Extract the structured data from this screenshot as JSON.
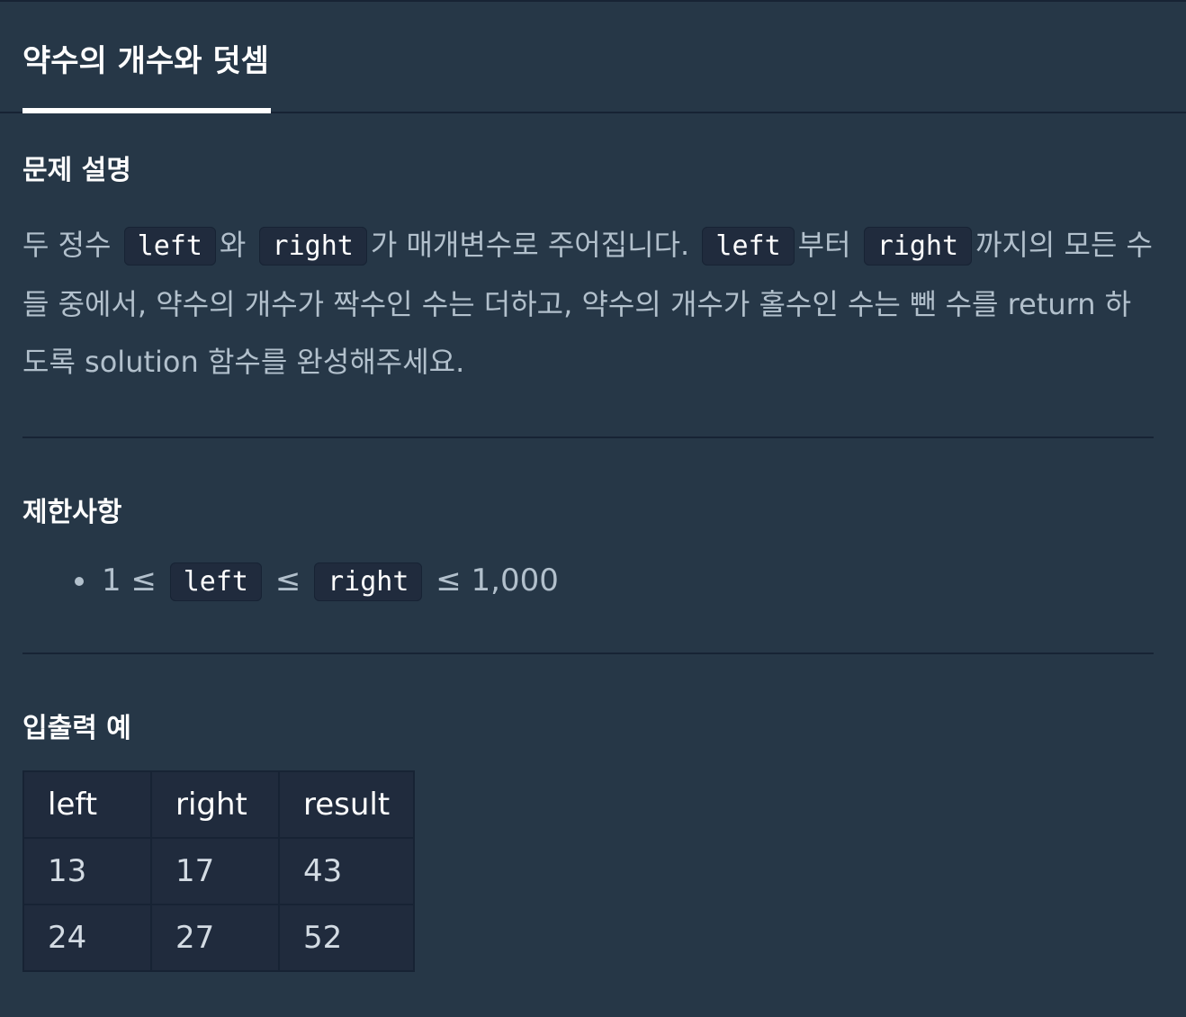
{
  "tab": {
    "title": "약수의 개수와 덧셈"
  },
  "description": {
    "title": "문제 설명",
    "parts": [
      "두 정수",
      "left",
      "와",
      "right",
      "가 매개변수로 주어집니다.",
      "left",
      "부터",
      "right",
      "까지의 모든 수들 중에서, 약수의 개수가 짝수인 수는 더하고, 약수의 개수가 홀수인 수는 뺀 수를 return 하도록 solution 함수를 완성해주세요."
    ]
  },
  "constraints": {
    "title": "제한사항",
    "item": {
      "lead": "1 ≤",
      "code1": "left",
      "mid": "≤",
      "code2": "right",
      "tail": "≤ 1,000"
    }
  },
  "io": {
    "title": "입출력 예",
    "headers": [
      "left",
      "right",
      "result"
    ],
    "rows": [
      [
        "13",
        "17",
        "43"
      ],
      [
        "24",
        "27",
        "52"
      ]
    ]
  }
}
